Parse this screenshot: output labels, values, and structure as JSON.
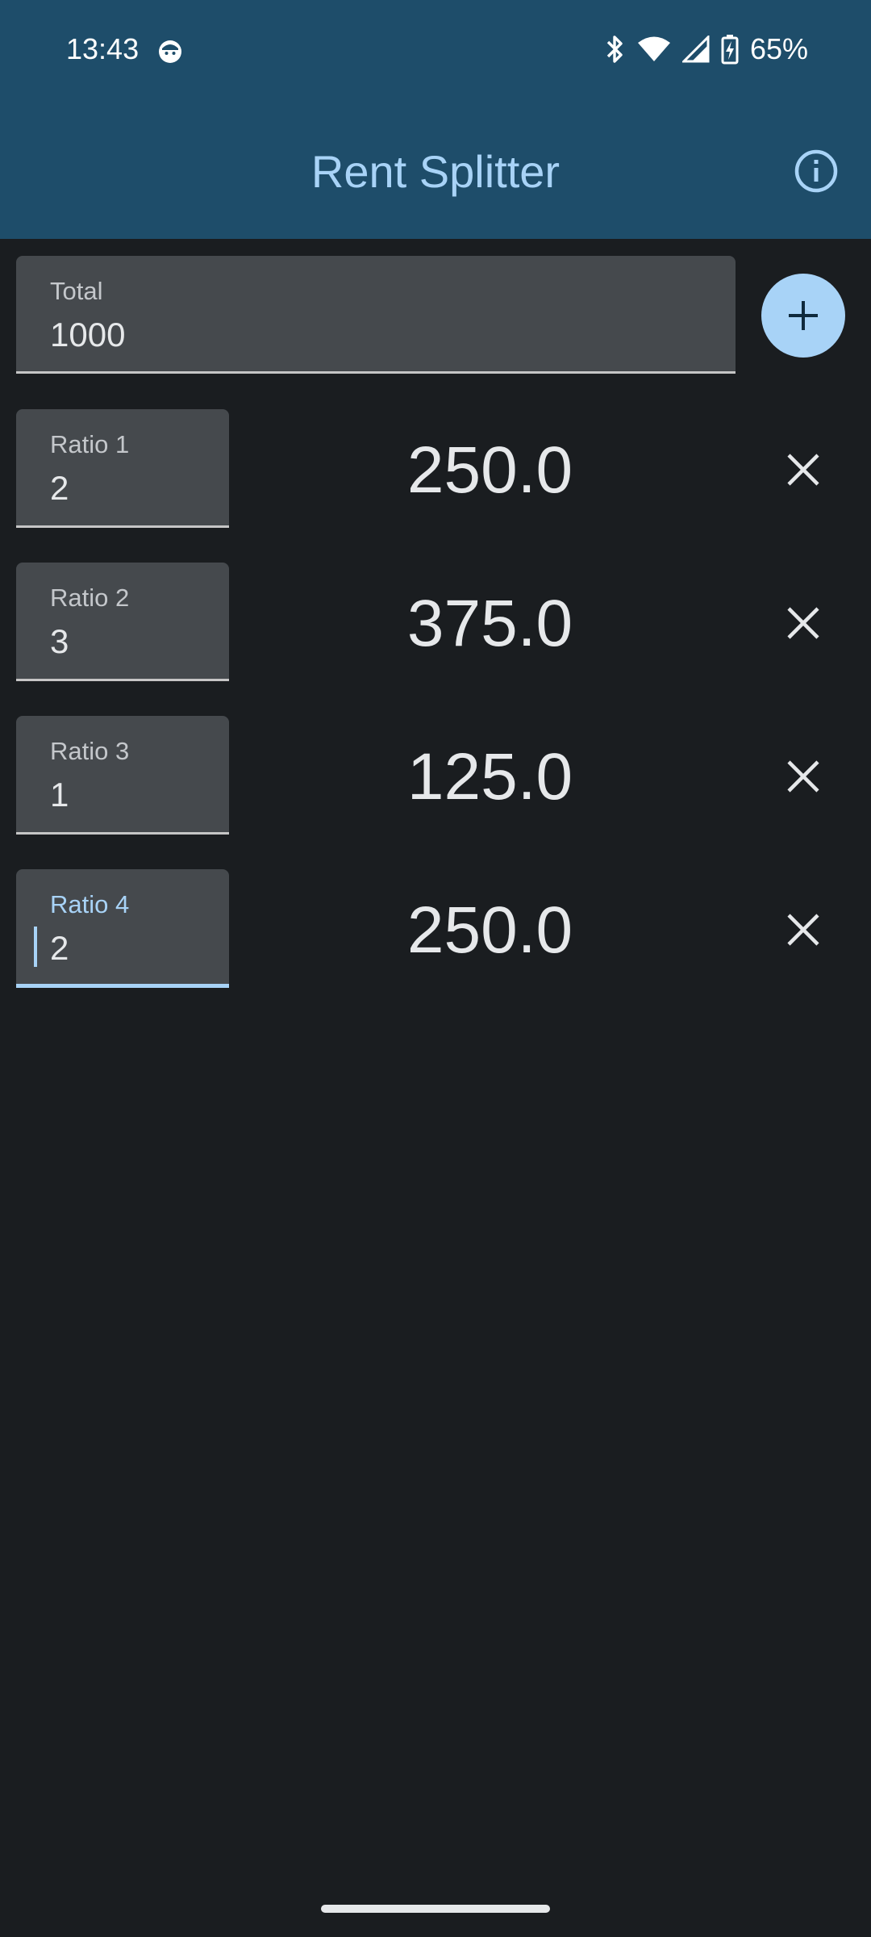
{
  "status": {
    "time": "13:43",
    "battery": "65%",
    "icons": [
      "face-icon",
      "bluetooth-icon",
      "wifi-icon",
      "signal-icon",
      "battery-charging-icon"
    ]
  },
  "app_bar": {
    "title": "Rent Splitter",
    "info_icon": "info-icon"
  },
  "total": {
    "label": "Total",
    "value": "1000"
  },
  "add_button_icon": "plus-icon",
  "rows": [
    {
      "label": "Ratio 1",
      "value": "2",
      "share": "250.0"
    },
    {
      "label": "Ratio 2",
      "value": "3",
      "share": "375.0"
    },
    {
      "label": "Ratio 3",
      "value": "1",
      "share": "125.0"
    },
    {
      "label": "Ratio 4",
      "value": "2",
      "share": "250.0"
    }
  ],
  "remove_icon": "close-icon",
  "colors": {
    "app_bar": "#1e4d6a",
    "background": "#1a1d20",
    "accent": "#a8d3f7",
    "field": "#45494d"
  }
}
